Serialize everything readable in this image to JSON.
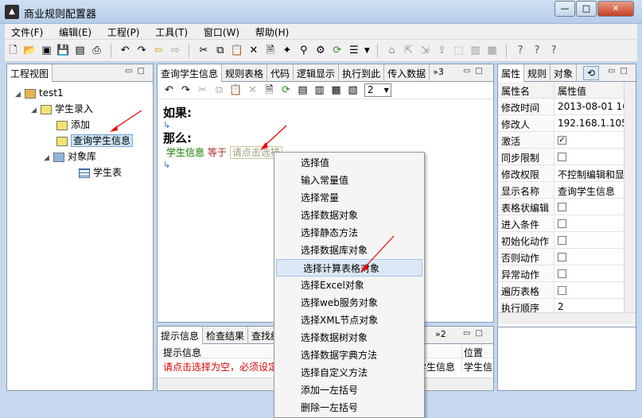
{
  "window": {
    "title": "商业规则配置器",
    "minimize": "—",
    "maximize": "□",
    "close": "✕"
  },
  "menu": [
    "文件(F)",
    "编辑(E)",
    "工程(P)",
    "工具(T)",
    "窗口(W)",
    "帮助(H)"
  ],
  "project_view": {
    "tab": "工程视图",
    "tree": {
      "root": "test1",
      "group": "学生录入",
      "items": [
        "添加",
        "查询学生信息"
      ],
      "objlib": "对象库",
      "table": "学生表"
    }
  },
  "editor": {
    "tabs": [
      "查询学生信息",
      "规则表格",
      "代码",
      "逻辑显示",
      "执行到此",
      "传入数据"
    ],
    "overflow": "»3",
    "zoom_value": "2",
    "if_label": "如果:",
    "then_label": "那么:",
    "rule_subject": "学生信息",
    "rule_op": "等于",
    "rule_placeholder": "请点击选择"
  },
  "props": {
    "tabs": [
      "属性",
      "规则",
      "对象"
    ],
    "col_name": "属性名",
    "col_value": "属性值",
    "rows": [
      {
        "name": "修改时间",
        "value": "2013-08-01 16"
      },
      {
        "name": "修改人",
        "value": "192.168.1.105"
      },
      {
        "name": "激活",
        "value": "",
        "check": "✓"
      },
      {
        "name": "同步限制",
        "value": "",
        "check": ""
      },
      {
        "name": "修改权限",
        "value": "不控制编辑和显"
      },
      {
        "name": "显示名称",
        "value": "查询学生信息"
      },
      {
        "name": "表格状编辑",
        "value": "",
        "check": ""
      },
      {
        "name": "进入条件",
        "value": "",
        "check": ""
      },
      {
        "name": "初始化动作",
        "value": "",
        "check": ""
      },
      {
        "name": "否则动作",
        "value": "",
        "check": ""
      },
      {
        "name": "异常动作",
        "value": "",
        "check": ""
      },
      {
        "name": "遍历表格",
        "value": "",
        "check": ""
      },
      {
        "name": "执行顺序",
        "value": "2"
      }
    ]
  },
  "bottom": {
    "tabs": [
      "提示信息",
      "检查结果",
      "查找结"
    ],
    "overflow": "»2",
    "col_info": "提示信息",
    "col_pos": "位置",
    "message": "请点击选择为空，必须设定",
    "cell1": "学生信息",
    "cell2": "学生信"
  },
  "context_menu": [
    "选择值",
    "输入常量值",
    "选择常量",
    "选择数据对象",
    "选择静态方法",
    "选择数据库对象",
    "选择计算表格对象",
    "选择Excel对象",
    "选择web服务对象",
    "选择XML节点对象",
    "选择数据树对象",
    "选择数据字典方法",
    "选择自定义方法",
    "添加一左括号",
    "删除一左括号"
  ],
  "colors": {
    "accent": "#cde6f7",
    "error": "#e00000",
    "rule_subject": "#1a7f1a"
  }
}
